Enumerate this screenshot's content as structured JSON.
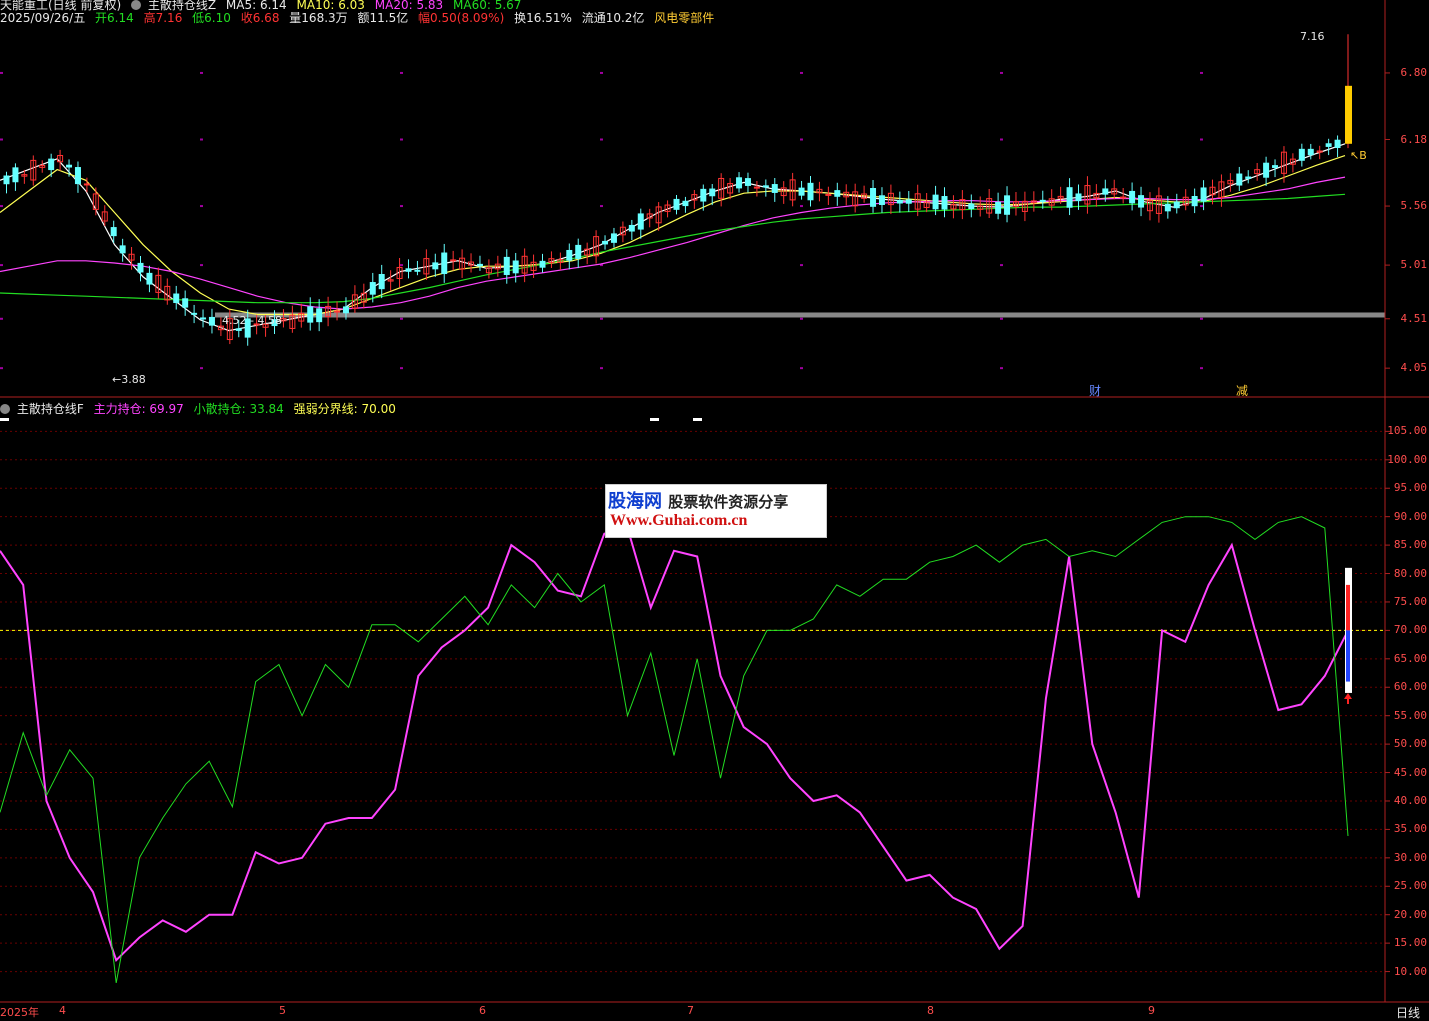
{
  "colors": {
    "background": "#000000",
    "up_candle": "#ff3333",
    "down_candle": "#66ffff",
    "ma5": "#ffffff",
    "ma10": "#ffff55",
    "ma20": "#ff44ff",
    "ma60": "#22dd22",
    "main_force": "#ff44ff",
    "retail": "#22dd22",
    "threshold": "#ffff00",
    "axis": "#ff4d4d"
  },
  "header": {
    "stock": "天能重工(日线 前复权)",
    "indicator": "主散持仓线Z",
    "ma5": "MA5: 6.14",
    "ma10": "MA10: 6.03",
    "ma20": "MA20: 5.83",
    "ma60": "MA60: 5.67"
  },
  "quote": {
    "date": "2025/09/26/五",
    "open": "开6.14",
    "high": "高7.16",
    "low": "低6.10",
    "close": "收6.68",
    "volume": "量168.3万",
    "amount": "额11.5亿",
    "change": "幅0.50(8.09%)",
    "turnover": "换16.51%",
    "float": "流通10.2亿",
    "sector": "风电零部件"
  },
  "price_chart": {
    "ylim": [
      3.8,
      7.2
    ],
    "axis_ticks": [
      "6.80",
      "6.18",
      "5.56",
      "5.01",
      "4.51",
      "4.05"
    ],
    "axis_values": [
      6.8,
      6.18,
      5.56,
      5.01,
      4.51,
      4.05
    ],
    "high_note": "7.16",
    "low_note": "3.88",
    "range_note": "4.52 - 4.58",
    "support_level": 4.55,
    "signal_b": "B",
    "event_cai": "财",
    "event_jian": "减"
  },
  "sub_header": {
    "indicator": "主散持仓线F",
    "main_force": "主力持仓: 69.97",
    "retail": "小散持仓: 33.84",
    "threshold": "强弱分界线: 70.00"
  },
  "sub_chart": {
    "ylim": [
      5,
      107
    ],
    "threshold_value": 70,
    "axis_ticks": [
      "105.00",
      "100.00",
      "95.00",
      "90.00",
      "85.00",
      "80.00",
      "75.00",
      "70.00",
      "65.00",
      "60.00",
      "55.00",
      "50.00",
      "45.00",
      "40.00",
      "35.00",
      "30.00",
      "25.00",
      "20.00",
      "15.00",
      "10.00"
    ]
  },
  "date_axis": {
    "labels": [
      "2025年",
      "4",
      "5",
      "6",
      "7",
      "8",
      "9"
    ]
  },
  "period_button": "日线",
  "watermark": {
    "site_name": "股海网",
    "slogan": "股票软件资源分享",
    "url": "Www.Guhai.com.cn"
  },
  "chart_data": [
    {
      "type": "candlestick",
      "title": "天能重工(日线 前复权)",
      "series": [
        {
          "name": "MA5",
          "values": [
            5.8,
            5.9,
            6.0,
            5.7,
            5.2,
            4.9,
            4.7,
            4.5,
            4.4,
            4.45,
            4.5,
            4.55,
            4.6,
            4.8,
            4.95,
            5.0,
            5.05,
            4.98,
            5.0,
            5.02,
            5.1,
            5.2,
            5.35,
            5.5,
            5.6,
            5.7,
            5.78,
            5.72,
            5.7,
            5.68,
            5.65,
            5.62,
            5.6,
            5.58,
            5.56,
            5.55,
            5.58,
            5.62,
            5.65,
            5.7,
            5.6,
            5.55,
            5.62,
            5.75,
            5.85,
            5.95,
            6.05,
            6.14
          ]
        },
        {
          "name": "MA10",
          "values": [
            5.5,
            5.7,
            5.9,
            5.8,
            5.5,
            5.2,
            4.95,
            4.75,
            4.6,
            4.55,
            4.55,
            4.55,
            4.6,
            4.7,
            4.8,
            4.9,
            4.97,
            5.0,
            5.0,
            5.02,
            5.05,
            5.12,
            5.22,
            5.35,
            5.48,
            5.6,
            5.68,
            5.7,
            5.7,
            5.68,
            5.66,
            5.64,
            5.62,
            5.6,
            5.58,
            5.57,
            5.58,
            5.6,
            5.62,
            5.64,
            5.62,
            5.6,
            5.6,
            5.66,
            5.74,
            5.84,
            5.94,
            6.03
          ]
        },
        {
          "name": "MA20",
          "values": [
            4.95,
            5.0,
            5.05,
            5.05,
            5.03,
            5.0,
            4.95,
            4.88,
            4.8,
            4.72,
            4.66,
            4.62,
            4.6,
            4.62,
            4.66,
            4.72,
            4.8,
            4.86,
            4.9,
            4.94,
            4.98,
            5.02,
            5.08,
            5.15,
            5.22,
            5.3,
            5.38,
            5.45,
            5.5,
            5.54,
            5.57,
            5.59,
            5.6,
            5.61,
            5.61,
            5.6,
            5.6,
            5.61,
            5.62,
            5.63,
            5.63,
            5.62,
            5.62,
            5.64,
            5.68,
            5.72,
            5.78,
            5.83
          ]
        },
        {
          "name": "MA60",
          "values": [
            4.75,
            4.74,
            4.73,
            4.72,
            4.71,
            4.7,
            4.69,
            4.68,
            4.67,
            4.66,
            4.66,
            4.66,
            4.67,
            4.7,
            4.75,
            4.8,
            4.86,
            4.92,
            4.97,
            5.02,
            5.07,
            5.13,
            5.18,
            5.23,
            5.28,
            5.33,
            5.37,
            5.41,
            5.44,
            5.46,
            5.48,
            5.5,
            5.51,
            5.52,
            5.53,
            5.54,
            5.55,
            5.55,
            5.56,
            5.57,
            5.58,
            5.59,
            5.6,
            5.61,
            5.62,
            5.63,
            5.65,
            5.67
          ]
        }
      ]
    },
    {
      "type": "line",
      "title": "主散持仓线F",
      "ylim": [
        5,
        107
      ],
      "series": [
        {
          "name": "主力持仓",
          "values": [
            84,
            78,
            40,
            30,
            24,
            12,
            16,
            19,
            17,
            20,
            20,
            31,
            29,
            30,
            36,
            37,
            37,
            42,
            62,
            67,
            70,
            74,
            85,
            82,
            77,
            76,
            87,
            88,
            74,
            84,
            83,
            62,
            53,
            50,
            44,
            40,
            41,
            38,
            32,
            26,
            27,
            23,
            21,
            14,
            18,
            58,
            83,
            50,
            38,
            23,
            70,
            68,
            78,
            85,
            70,
            56,
            57,
            62,
            69.97
          ]
        },
        {
          "name": "小散持仓",
          "values": [
            38,
            52,
            41,
            49,
            44,
            8,
            30,
            37,
            43,
            47,
            39,
            61,
            64,
            55,
            64,
            60,
            71,
            71,
            68,
            72,
            76,
            71,
            78,
            74,
            80,
            75,
            78,
            55,
            66,
            48,
            65,
            44,
            62,
            70,
            70,
            72,
            78,
            76,
            79,
            79,
            82,
            83,
            85,
            82,
            85,
            86,
            83,
            84,
            83,
            86,
            89,
            90,
            90,
            89,
            86,
            89,
            90,
            88,
            33.84
          ]
        }
      ]
    }
  ]
}
